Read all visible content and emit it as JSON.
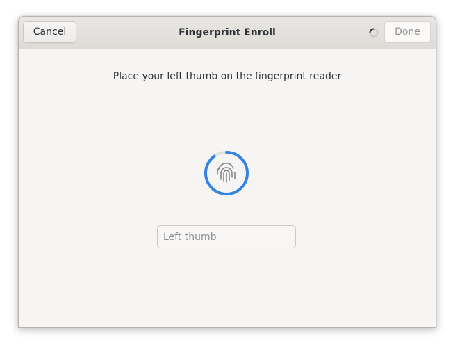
{
  "dialog": {
    "title": "Fingerprint Enroll",
    "cancel_label": "Cancel",
    "done_label": "Done",
    "done_enabled": false,
    "spinner_icon": "spinner-icon"
  },
  "enroll": {
    "instruction": "Place your left thumb on the fingerprint reader",
    "progress_fraction": 0.9,
    "fingerprint_icon": "fingerprint-icon",
    "accent_color": "#3584e4"
  },
  "name_entry": {
    "value": "",
    "placeholder": "Left thumb"
  }
}
